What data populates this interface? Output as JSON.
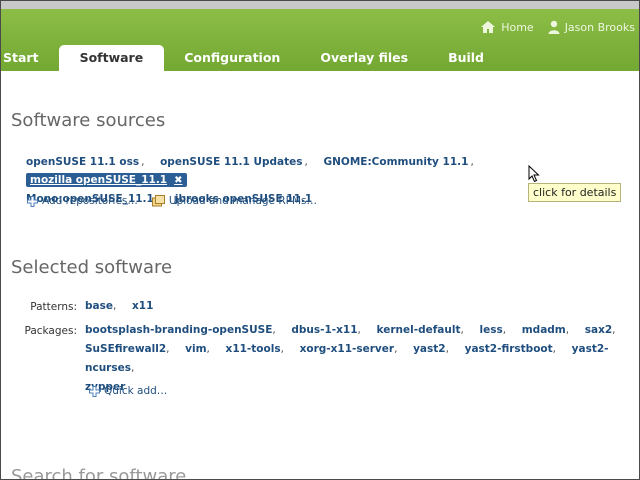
{
  "header": {
    "home_label": "Home",
    "user_label": "Jason Brooks",
    "home_icon": "home-icon",
    "user_icon": "user-icon"
  },
  "tabs": [
    {
      "label": "Start",
      "active": false
    },
    {
      "label": "Software",
      "active": true
    },
    {
      "label": "Configuration",
      "active": false
    },
    {
      "label": "Overlay files",
      "active": false
    },
    {
      "label": "Build",
      "active": false
    }
  ],
  "sources": {
    "heading": "Software sources",
    "items": [
      "openSUSE 11.1 oss",
      "openSUSE 11.1 Updates",
      "GNOME:Community 11.1",
      "mozilla openSUSE_11.1",
      "Mono:openSUSE_11.1",
      "jbrooks openSUSE 11.1"
    ],
    "separator": ",",
    "selected_index": 3,
    "remove_glyph": "✖",
    "add_repositories": "Add repositories…",
    "upload_rpms": "Upload and manage RPMs…",
    "tooltip": "click for details"
  },
  "selected": {
    "heading": "Selected software",
    "patterns_label": "Patterns:",
    "patterns": [
      "base",
      "x11"
    ],
    "packages_label": "Packages:",
    "packages": [
      "bootsplash-branding-openSUSE",
      "dbus-1-x11",
      "kernel-default",
      "less",
      "mdadm",
      "sax2",
      "SuSEfirewall2",
      "vim",
      "x11-tools",
      "xorg-x11-server",
      "yast2",
      "yast2-firstboot",
      "yast2-ncurses",
      "zypper"
    ],
    "quick_add": "Quick add…"
  },
  "search": {
    "heading": "Search for software"
  },
  "colors": {
    "header_green": "#7fb33c",
    "link_blue": "#1f4e7e",
    "selected_bg": "#2a5e95",
    "tooltip_bg": "#ffffcc"
  }
}
